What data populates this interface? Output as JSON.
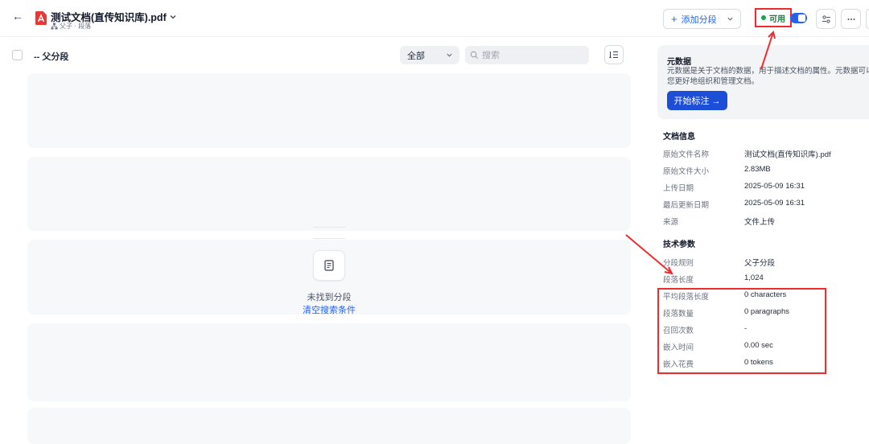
{
  "header": {
    "doc_title": "测试文档(直传知识库).pdf",
    "doc_subtitle": "父子 · 段落",
    "add_segment_label": "添加分段",
    "status_label": "可用"
  },
  "toolbar": {
    "segment_label": "-- 父分段",
    "filter_value": "全部",
    "search_placeholder": "搜索"
  },
  "empty_state": {
    "message": "未找到分段",
    "clear_link": "清空搜索条件"
  },
  "metadata": {
    "title": "元数据",
    "desc_line1": "元数据是关于文档的数据，用于描述文档的属性。元数据可以帮",
    "desc_line2": "您更好地组织和管理文档。",
    "start_button": "开始标注 →"
  },
  "doc_info": {
    "title": "文档信息",
    "rows": [
      {
        "key": "原始文件名称",
        "value": "测试文档(直传知识库).pdf"
      },
      {
        "key": "原始文件大小",
        "value": "2.83MB"
      },
      {
        "key": "上传日期",
        "value": "2025-05-09 16:31"
      },
      {
        "key": "最后更新日期",
        "value": "2025-05-09 16:31"
      },
      {
        "key": "来源",
        "value": "文件上传"
      }
    ]
  },
  "tech_params": {
    "title": "技术参数",
    "rows": [
      {
        "key": "分段规则",
        "value": "父子分段"
      },
      {
        "key": "段落长度",
        "value": "1,024"
      },
      {
        "key": "平均段落长度",
        "value": "0 characters"
      },
      {
        "key": "段落数量",
        "value": "0 paragraphs"
      },
      {
        "key": "召回次数",
        "value": "-"
      },
      {
        "key": "嵌入时间",
        "value": "0.00 sec"
      },
      {
        "key": "嵌入花费",
        "value": "0 tokens"
      }
    ]
  },
  "colors": {
    "accent": "#2563eb",
    "status_green": "#16a34a",
    "annotation_red": "#ef2b2b"
  }
}
